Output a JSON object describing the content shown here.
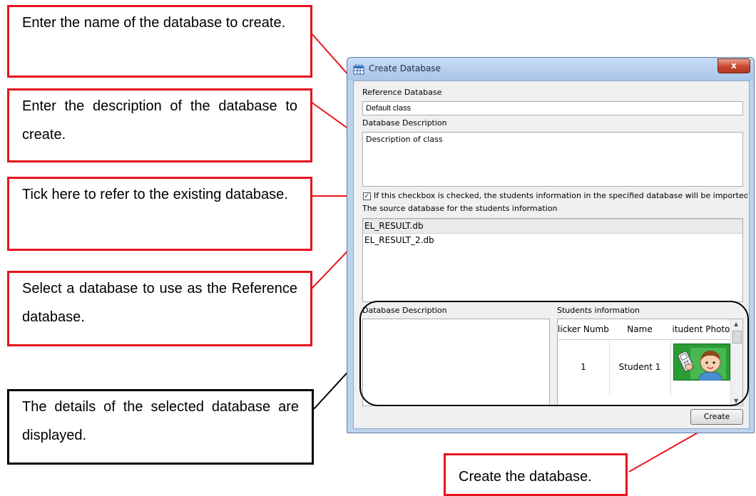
{
  "callouts": {
    "name": "Enter the name of the database to create.",
    "description": "Enter the description of the database to create.",
    "checkbox": "Tick here to refer to the existing database.",
    "select": "Select a database to use as the Reference database.",
    "details": "The details of the selected database are displayed.",
    "create": "Create the database."
  },
  "dialog": {
    "title": "Create Database",
    "close_label": "x",
    "reference_label": "Reference Database",
    "reference_value": "Default class",
    "description_label": "Database Description",
    "description_value": "Description of class",
    "checkbox_checked": true,
    "checkbox_mark": "✓",
    "checkbox_text": "If this checkbox is checked, the students information in the specified database will be imported to th",
    "source_label": "The source database for the students information",
    "databases": [
      "EL_RESULT.db",
      "EL_RESULT_2.db"
    ],
    "selected_database": "EL_RESULT.db",
    "details_description_label": "Database Description",
    "students_label": "Students information",
    "students_columns": [
      "licker Numbe",
      "Name",
      "itudent Photo"
    ],
    "students_rows": [
      {
        "number": "1",
        "name": "Student 1",
        "photo_icon": "student-photo"
      }
    ],
    "create_button": "Create"
  },
  "colors": {
    "callout_border": "#e8141c",
    "leader_line": "#e8141c",
    "details_border": "#000000"
  }
}
